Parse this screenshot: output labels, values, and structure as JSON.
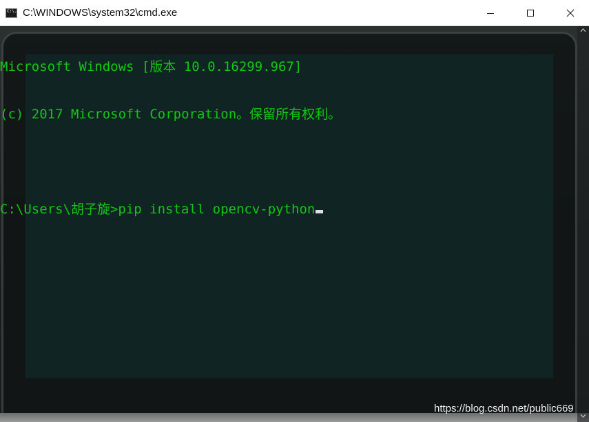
{
  "window": {
    "title": "C:\\WINDOWS\\system32\\cmd.exe",
    "app_icon": "console-icon",
    "app_icon_text": "C:\\.",
    "controls": {
      "minimize_icon": "minimize-icon",
      "maximize_icon": "maximize-icon",
      "close_icon": "close-icon"
    }
  },
  "console": {
    "text_color": "#14c614",
    "lines": [
      "Microsoft Windows [版本 10.0.16299.967]",
      "(c) 2017 Microsoft Corporation。保留所有权利。",
      "",
      "C:\\Users\\胡子旋>pip install opencv-python"
    ],
    "cursor": "block-cursor"
  },
  "watermark": "https://blog.csdn.net/public669"
}
